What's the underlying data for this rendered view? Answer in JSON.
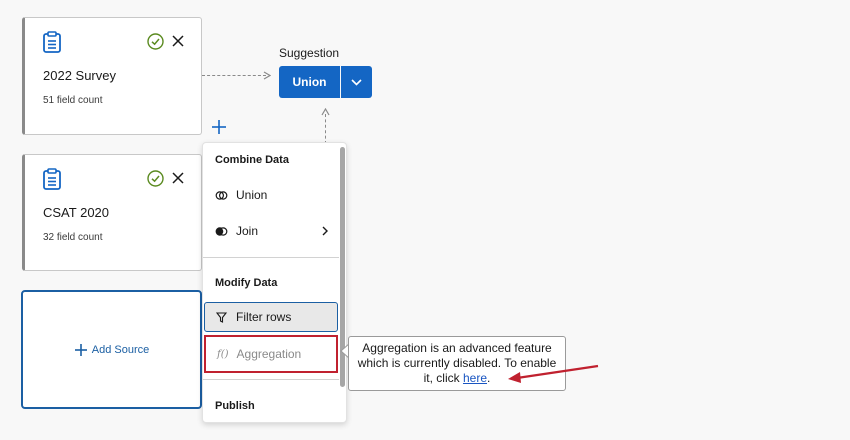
{
  "sources": [
    {
      "title": "2022 Survey",
      "field_count": "51 field count"
    },
    {
      "title": "CSAT 2020",
      "field_count": "32 field count"
    }
  ],
  "add_source_label": "Add Source",
  "suggestion": {
    "label": "Suggestion",
    "button": "Union"
  },
  "menu": {
    "sections": {
      "combine": "Combine Data",
      "modify": "Modify Data",
      "publish": "Publish"
    },
    "items": {
      "union": "Union",
      "join": "Join",
      "filter": "Filter rows",
      "aggregation": "Aggregation"
    },
    "aggregation_icon_text": "f()"
  },
  "tooltip": {
    "text": "Aggregation is an advanced feature which is currently disabled. To enable it, click ",
    "link": "here",
    "end": "."
  },
  "colors": {
    "accent": "#1466c4",
    "highlight_box": "#c0212f",
    "annotation_arrow": "#c0212f",
    "check": "#5a8a1f"
  },
  "icons": [
    "clipboard-icon",
    "check-circle-icon",
    "close-icon",
    "plus-icon",
    "chevron-down-icon",
    "union-icon",
    "join-icon",
    "chevron-right-icon",
    "filter-icon",
    "function-icon"
  ]
}
